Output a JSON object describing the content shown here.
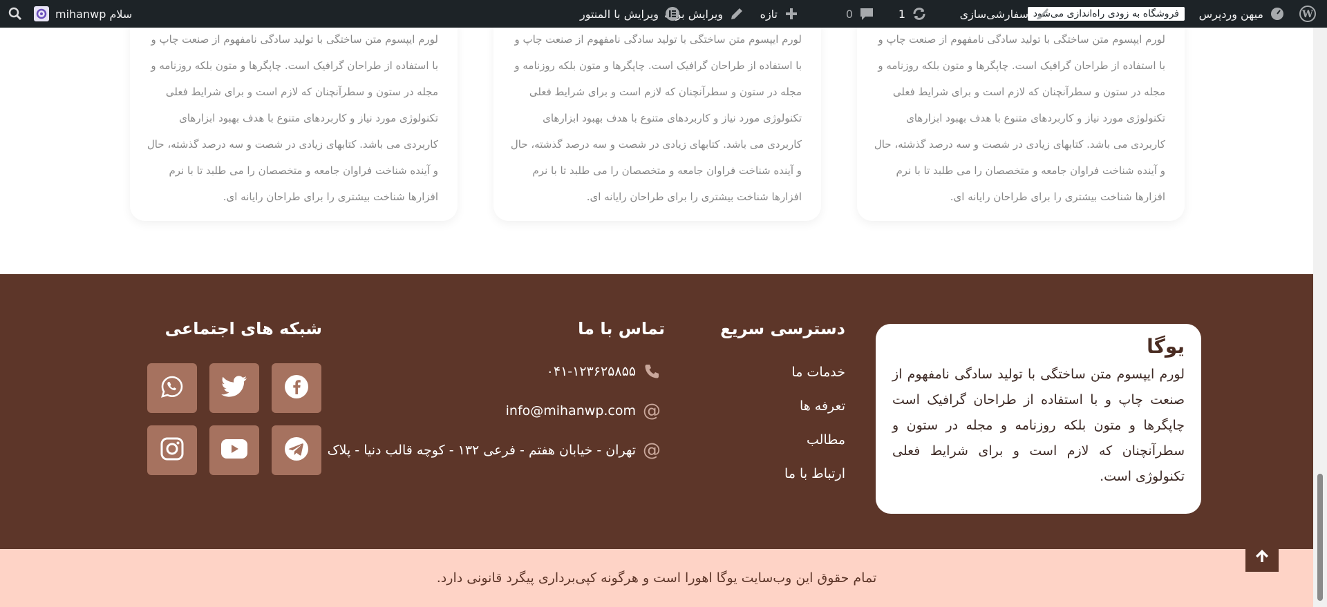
{
  "adminbar": {
    "site_name": "میهن وردپرس",
    "store_notice": "فروشگاه به زودی راه‌اندازی می‌شود",
    "customize": "سفارشی‌سازی",
    "updates_count": "1",
    "comments_count": "0",
    "new": "تازه",
    "edit_page": "ویرایش برگه",
    "edit_elementor": "ویرایش با المنتور",
    "greeting": "سلام mihanwp"
  },
  "cards": [
    {
      "text": "لورم ایپسوم متن ساختگی با تولید سادگی نامفهوم از صنعت چاپ و با استفاده از طراحان گرافیک است. چاپگرها و متون بلکه روزنامه و مجله در ستون و سطرآنچنان که لازم است و برای شرایط فعلی تکنولوژی مورد نیاز و کاربردهای متنوع با هدف بهبود ابزارهای کاربردی می باشد. کتابهای زیادی در شصت و سه درصد گذشته، حال و آینده شناخت فراوان جامعه و متخصصان را می طلبد تا با نرم افزارها شناخت بیشتری را برای طراحان رایانه ای."
    },
    {
      "text": "لورم ایپسوم متن ساختگی با تولید سادگی نامفهوم از صنعت چاپ و با استفاده از طراحان گرافیک است. چاپگرها و متون بلکه روزنامه و مجله در ستون و سطرآنچنان که لازم است و برای شرایط فعلی تکنولوژی مورد نیاز و کاربردهای متنوع با هدف بهبود ابزارهای کاربردی می باشد. کتابهای زیادی در شصت و سه درصد گذشته، حال و آینده شناخت فراوان جامعه و متخصصان را می طلبد تا با نرم افزارها شناخت بیشتری را برای طراحان رایانه ای."
    },
    {
      "text": "لورم ایپسوم متن ساختگی با تولید سادگی نامفهوم از صنعت چاپ و با استفاده از طراحان گرافیک است. چاپگرها و متون بلکه روزنامه و مجله در ستون و سطرآنچنان که لازم است و برای شرایط فعلی تکنولوژی مورد نیاز و کاربردهای متنوع با هدف بهبود ابزارهای کاربردی می باشد. کتابهای زیادی در شصت و سه درصد گذشته، حال و آینده شناخت فراوان جامعه و متخصصان را می طلبد تا با نرم افزارها شناخت بیشتری را برای طراحان رایانه ای."
    }
  ],
  "footer": {
    "about": {
      "title": "یوگا",
      "text": "لورم ایپسوم متن ساختگی با تولید سادگی نامفهوم از صنعت چاپ و با استفاده از طراحان گرافیک است چاپگرها و متون بلکه روزنامه و مجله در ستون و سطرآنچنان که لازم است و برای شرایط فعلی تکنولوژی است."
    },
    "quick_access": {
      "title": "دسترسی سریع",
      "links": [
        "خدمات ما",
        "تعرفه ها",
        "مطالب",
        "ارتباط با ما"
      ]
    },
    "contact": {
      "title": "تماس با ما",
      "phone": "۰۴۱-۱۲۳۶۲۵۸۵۵",
      "email": "info@mihanwp.com",
      "address": "تهران - خیابان هفتم - فرعی ۱۳۲ - کوچه قالب دنیا - پلاک ۰"
    },
    "social": {
      "title": "شبکه های اجتماعی",
      "icons": [
        "facebook-icon",
        "twitter-icon",
        "whatsapp-icon",
        "telegram-icon",
        "youtube-icon",
        "instagram-icon"
      ]
    },
    "copyright": "تمام حقوق این وب‌سایت یوگا اهورا است و هرگونه کپی‌برداری پیگرد قانونی دارد."
  },
  "colors": {
    "adminbar_bg": "#1d2327",
    "footer_bg": "#5d3629",
    "social_bg": "#a6725f",
    "copyright_bg": "#fed3c6"
  }
}
